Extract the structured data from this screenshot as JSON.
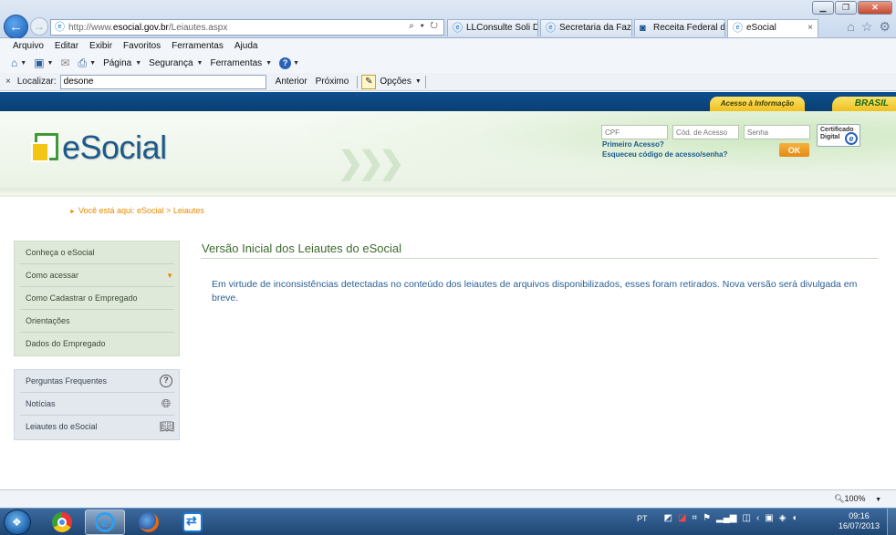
{
  "browser": {
    "url_prefix": "http://www.",
    "url_host": "esocial.gov.br",
    "url_path": "/Leiautes.aspx",
    "address_controls": "⌕ ▾ ↻",
    "tabs": [
      {
        "label": "LLConsulte Soli D...",
        "active": false
      },
      {
        "label": "Secretaria da Faze...",
        "active": false
      },
      {
        "label": "Receita Federal d...",
        "active": false
      },
      {
        "label": "eSocial",
        "active": true
      }
    ],
    "tab_close": "×",
    "menu": [
      "Arquivo",
      "Editar",
      "Exibir",
      "Favoritos",
      "Ferramentas",
      "Ajuda"
    ],
    "commands": {
      "page": "Página",
      "safety": "Segurança",
      "tools": "Ferramentas"
    },
    "find": {
      "close": "×",
      "label": "Localizar:",
      "value": "desone",
      "previous": "Anterior",
      "next": "Próximo",
      "options": "Opções"
    },
    "zoom": "100%"
  },
  "header": {
    "acesso_informacao": "Acesso à Informação",
    "brasil": "BRASIL",
    "logo_text": "eSocial",
    "login": {
      "cpf_placeholder": "CPF",
      "code_placeholder": "Cód. de Acesso",
      "password_placeholder": "Senha",
      "first_access": "Primeiro Acesso?",
      "forgot": "Esqueceu código de acesso/senha?",
      "ok": "OK",
      "certificate_line1": "Certificado",
      "certificate_line2": "Digital",
      "certificate_mark": "e"
    }
  },
  "breadcrumb": {
    "prefix": "Você está aqui:",
    "home": "eSocial",
    "separator": ">",
    "current": "Leiautes"
  },
  "sidebar": {
    "main": [
      {
        "label": "Conheça o eSocial"
      },
      {
        "label": "Como acessar"
      },
      {
        "label": "Como Cadastrar o Empregado"
      },
      {
        "label": "Orientações"
      },
      {
        "label": "Dados do Empregado"
      }
    ],
    "secondary": [
      {
        "label": "Perguntas Frequentes",
        "icon": "help-icon"
      },
      {
        "label": "Notícias",
        "icon": "globe-icon"
      },
      {
        "label": "Leiautes do eSocial",
        "icon": "book-icon"
      }
    ]
  },
  "content": {
    "title": "Versão Inicial dos Leiautes do eSocial",
    "text": "Em virtude de inconsistências detectadas no conteúdo dos leiautes de arquivos disponibilizados, esses foram retirados. Nova versão será divulgada em breve."
  },
  "taskbar": {
    "language": "PT",
    "time": "09:16",
    "date": "16/07/2013"
  }
}
